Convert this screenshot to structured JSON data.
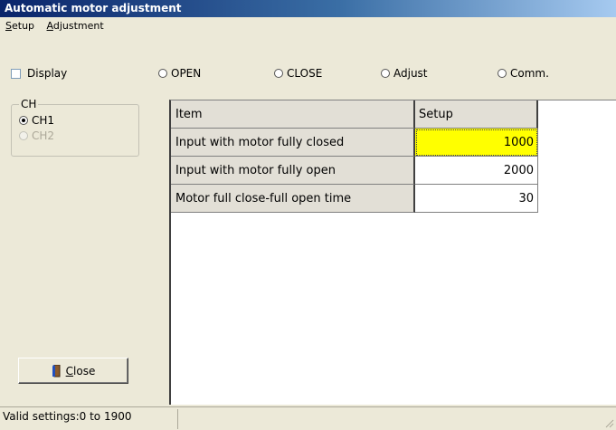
{
  "window": {
    "title": "Automatic motor adjustment"
  },
  "menu": [
    {
      "label": "Setup",
      "underline": "S",
      "rest": "etup"
    },
    {
      "label": "Adjustment",
      "underline": "A",
      "rest": "djustment"
    }
  ],
  "display_checkbox": {
    "label": "Display",
    "checked": false
  },
  "mode_radios": [
    {
      "label": "OPEN",
      "selected": false
    },
    {
      "label": "CLOSE",
      "selected": false
    },
    {
      "label": "Adjust",
      "selected": false
    },
    {
      "label": "Comm.",
      "selected": false
    }
  ],
  "channel_group": {
    "legend": "CH",
    "options": [
      {
        "label": "CH1",
        "selected": true,
        "enabled": true
      },
      {
        "label": "CH2",
        "selected": false,
        "enabled": false
      }
    ]
  },
  "close_button": {
    "label": "Close",
    "underline": "C",
    "rest": "lose"
  },
  "table": {
    "headers": {
      "item": "Item",
      "setup": "Setup"
    },
    "rows": [
      {
        "item": "Input with motor fully closed",
        "value": "1000",
        "selected": true
      },
      {
        "item": "Input with motor fully open",
        "value": "2000",
        "selected": false
      },
      {
        "item": "Motor full close-full open time",
        "value": "30",
        "selected": false
      }
    ]
  },
  "status": {
    "text": "Valid settings:0 to 1900"
  },
  "colors": {
    "selected_cell": "#ffff00",
    "titlebar": "#0a246a"
  }
}
